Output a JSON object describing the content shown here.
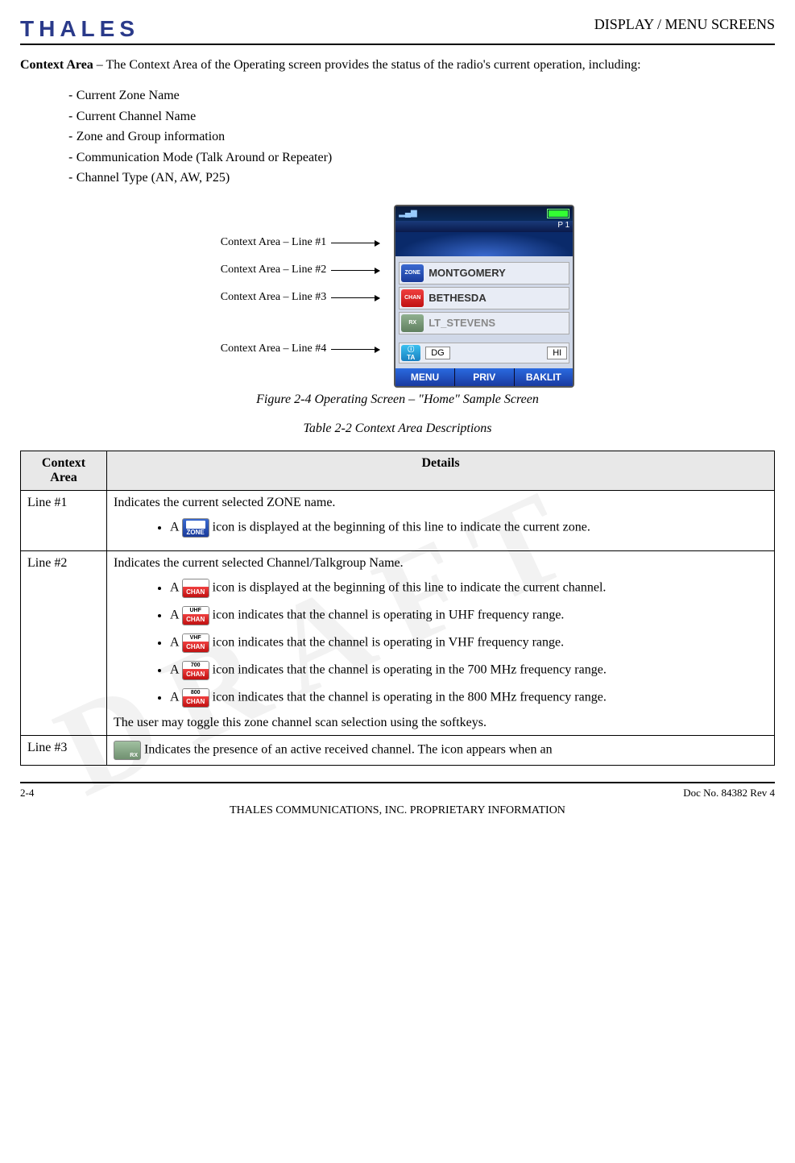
{
  "header": {
    "logo": "THALES",
    "section": "DISPLAY / MENU SCREENS"
  },
  "intro": {
    "lead": "Context Area",
    "text": " – The Context Area of the Operating screen provides the status of the radio's current operation, including:"
  },
  "context_bullets": [
    "Current Zone Name",
    "Current Channel Name",
    "Zone and Group information",
    "Communication Mode (Talk Around or Repeater)",
    "Channel Type (AN, AW, P25)"
  ],
  "callouts": [
    "Context Area – Line #1",
    "Context Area – Line #2",
    "Context Area – Line #3",
    "Context Area – Line #4"
  ],
  "phone": {
    "p_indicator": "P 1",
    "rows": [
      {
        "icon": "ZONE",
        "text": "MONTGOMERY",
        "grey": false
      },
      {
        "icon": "CHAN",
        "text": "BETHESDA",
        "grey": false
      },
      {
        "icon": "RX",
        "text": "LT_STEVENS",
        "grey": true
      }
    ],
    "ta_label": "TA",
    "tag_dg": "DG",
    "tag_hi": "HI",
    "softkeys": [
      "MENU",
      "PRIV",
      "BAKLIT"
    ]
  },
  "figure_caption": "Figure 2-4 Operating Screen – \"Home\" Sample Screen",
  "table_caption": "Table 2-2 Context Area Descriptions",
  "table": {
    "head": [
      "Context Area",
      "Details"
    ],
    "rows": [
      {
        "label": "Line #1",
        "lead": "Indicates the current selected ZONE name.",
        "items": [
          {
            "icon_top": "",
            "icon_bot": "ZONE",
            "class": "zone",
            "pre": "A ",
            "post": " icon is displayed at the beginning of this line to indicate the current zone."
          }
        ],
        "trail": ""
      },
      {
        "label": "Line #2",
        "lead": "Indicates the current selected Channel/Talkgroup Name.",
        "items": [
          {
            "icon_top": "",
            "icon_bot": "CHAN",
            "class": "chan",
            "pre": "A ",
            "post": " icon is displayed at the beginning of this line to indicate the current channel."
          },
          {
            "icon_top": "UHF",
            "icon_bot": "CHAN",
            "class": "chan",
            "pre": "A ",
            "post": " icon indicates that the channel is operating in UHF frequency range."
          },
          {
            "icon_top": "VHF",
            "icon_bot": "CHAN",
            "class": "chan",
            "pre": "A ",
            "post": " icon indicates that the channel is operating in VHF frequency range."
          },
          {
            "icon_top": "700",
            "icon_bot": "CHAN",
            "class": "chan",
            "pre": "A ",
            "post": " icon indicates that the channel is operating in the 700 MHz frequency range."
          },
          {
            "icon_top": "800",
            "icon_bot": "CHAN",
            "class": "chan",
            "pre": "A ",
            "post": " icon indicates that the channel is operating in the 800 MHz frequency range."
          }
        ],
        "trail": "The user may toggle this zone channel scan selection using the softkeys."
      },
      {
        "label": "Line #3",
        "lead": "",
        "items": [
          {
            "icon_top": "",
            "icon_bot": "RX",
            "class": "rx",
            "pre": "",
            "post": " Indicates the presence of an active received channel.  The icon appears when an"
          }
        ],
        "trail": ""
      }
    ]
  },
  "footer": {
    "page": "2-4",
    "doc": "Doc No. 84382 Rev 4",
    "prop": "THALES COMMUNICATIONS, INC. PROPRIETARY INFORMATION"
  }
}
